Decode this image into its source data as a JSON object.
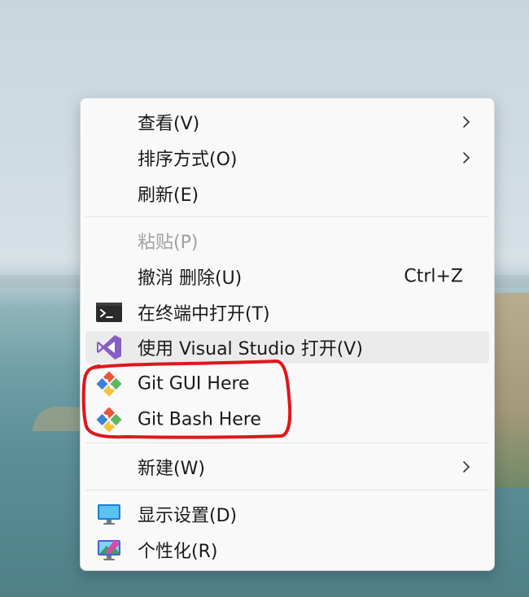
{
  "menu": {
    "items": [
      {
        "label": "查看(V)",
        "submenu": true
      },
      {
        "label": "排序方式(O)",
        "submenu": true
      },
      {
        "label": "刷新(E)"
      },
      {
        "label": "粘贴(P)",
        "disabled": true
      },
      {
        "label": "撤消 删除(U)",
        "shortcut": "Ctrl+Z"
      },
      {
        "label": "在终端中打开(T)",
        "icon": "terminal-icon"
      },
      {
        "label": "使用 Visual Studio 打开(V)",
        "icon": "visual-studio-icon",
        "highlighted": true
      },
      {
        "label": "Git GUI Here",
        "icon": "git-icon"
      },
      {
        "label": "Git Bash Here",
        "icon": "git-icon"
      },
      {
        "label": "新建(W)",
        "submenu": true
      },
      {
        "label": "显示设置(D)",
        "icon": "display-settings-icon"
      },
      {
        "label": "个性化(R)",
        "icon": "personalize-icon"
      }
    ]
  },
  "colors": {
    "menu_background": "#f9f9f9",
    "highlight": "#ebebeb",
    "disabled_text": "#a0a0a0",
    "annotation": "#e0161b",
    "visual_studio": "#865fc5",
    "git_red": "#e8543a",
    "git_green": "#5bb85c",
    "git_blue": "#3b82d6",
    "git_yellow": "#f5c33b"
  }
}
